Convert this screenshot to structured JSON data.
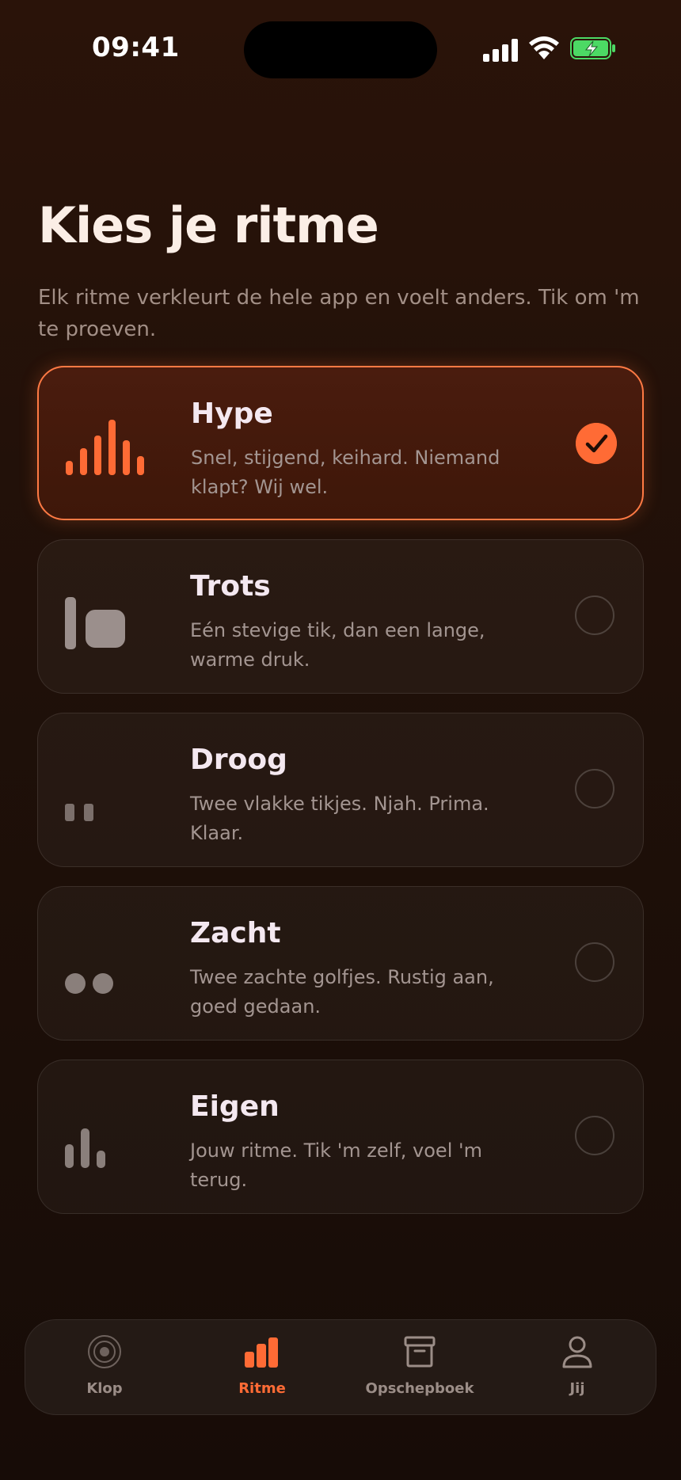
{
  "status_bar": {
    "time": "09:41"
  },
  "header": {
    "title": "Kies je ritme",
    "subtitle": "Elk ritme verkleurt de hele app en voelt anders. Tik om 'm te proeven."
  },
  "options": [
    {
      "name": "Hype",
      "description": "Snel, stijgend, keihard. Niemand klapt? Wij wel.",
      "selected": true,
      "icon": "rising-bars-icon"
    },
    {
      "name": "Trots",
      "description": "Eén stevige tik, dan een lange, warme druk.",
      "selected": false,
      "icon": "tap-hold-icon"
    },
    {
      "name": "Droog",
      "description": "Twee vlakke tikjes. Njah. Prima. Klaar.",
      "selected": false,
      "icon": "two-ticks-icon"
    },
    {
      "name": "Zacht",
      "description": "Twee zachte golfjes. Rustig aan, goed gedaan.",
      "selected": false,
      "icon": "two-dots-icon"
    },
    {
      "name": "Eigen",
      "description": "Jouw ritme. Tik 'm zelf, voel 'm terug.",
      "selected": false,
      "icon": "custom-bars-icon"
    }
  ],
  "tabbar": {
    "tabs": [
      {
        "label": "Klop",
        "icon": "pulse-icon",
        "active": false
      },
      {
        "label": "Ritme",
        "icon": "bars-icon",
        "active": true
      },
      {
        "label": "Opschepboek",
        "icon": "archive-icon",
        "active": false
      },
      {
        "label": "Jij",
        "icon": "person-icon",
        "active": false
      }
    ]
  },
  "colors": {
    "accent": "#ff6b35",
    "background": "#1f1009",
    "muted": "#a39591"
  }
}
